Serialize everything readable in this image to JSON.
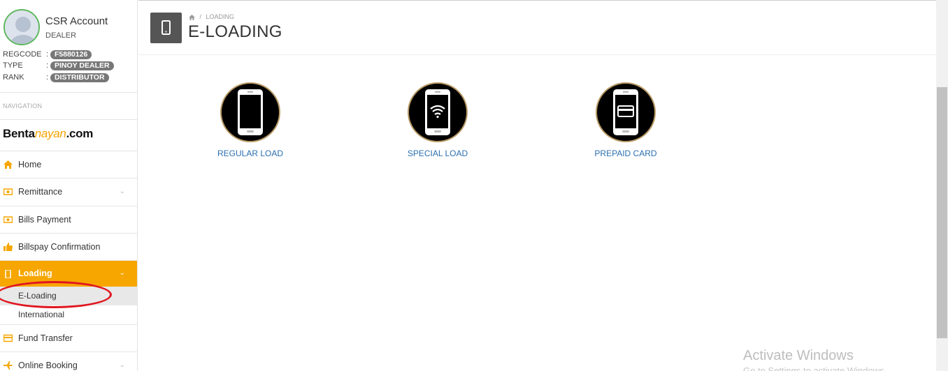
{
  "profile": {
    "name": "CSR Account",
    "role": "DEALER",
    "regcode_label": "REGCODE",
    "regcode": "F5880126",
    "type_label": "TYPE",
    "type": "PINOY DEALER",
    "rank_label": "RANK",
    "rank": "DISTRIBUTOR",
    "separator": ":"
  },
  "nav_heading": "NAVIGATION",
  "brand": {
    "part1": "Benta",
    "part2": "nayan",
    "part3": ".com"
  },
  "nav": {
    "home": "Home",
    "remittance": "Remittance",
    "bills_payment": "Bills Payment",
    "billspay_confirmation": "Billspay Confirmation",
    "loading": "Loading",
    "loading_sub": [
      "E-Loading",
      "International"
    ],
    "fund_transfer": "Fund Transfer",
    "online_booking": "Online Booking"
  },
  "header": {
    "breadcrumb": "LOADING",
    "breadcrumb_sep": "/",
    "title": "E-LOADING"
  },
  "tiles": [
    {
      "label": "REGULAR LOAD"
    },
    {
      "label": "SPECIAL LOAD"
    },
    {
      "label": "PREPAID CARD"
    }
  ],
  "watermark": {
    "line1": "Activate Windows",
    "line2": "Go to Settings to activate Windows."
  },
  "colors": {
    "accent": "#f7a600",
    "link": "#2a6fb0",
    "badge": "#777777",
    "annotation": "#e0161f"
  }
}
